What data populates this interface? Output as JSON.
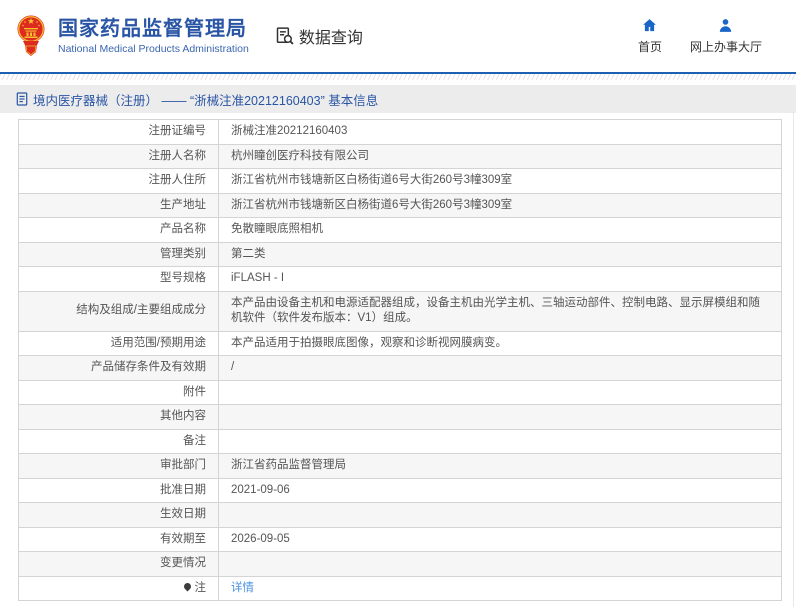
{
  "header": {
    "org_name_cn": "国家药品监督管理局",
    "org_name_en": "National Medical Products Administration",
    "query_label": "数据查询",
    "nav": {
      "home": "首页",
      "service_hall": "网上办事大厅"
    }
  },
  "breadcrumb": {
    "text": "境内医疗器械（注册） —— “浙械注准20212160403” 基本信息"
  },
  "icons": {
    "emblem": "china-national-emblem",
    "query": "document-search-icon",
    "home": "home-icon",
    "service_hall": "person-icon",
    "breadcrumb": "document-icon",
    "note": "pin-icon"
  },
  "colors": {
    "brand_blue": "#2a55a5",
    "rule_blue": "#1d5fb0",
    "icon_blue": "#1a66c8",
    "link_blue": "#4a90e2",
    "crumb_bg": "#ececec",
    "row_alt_bg": "#f6f6f6",
    "emblem_red": "#dd2b20",
    "emblem_gold": "#f6c12f"
  },
  "table": {
    "rows": [
      {
        "label": "注册证编号",
        "value": "浙械注准20212160403"
      },
      {
        "label": "注册人名称",
        "value": "杭州瞳创医疗科技有限公司"
      },
      {
        "label": "注册人住所",
        "value": "浙江省杭州市钱塘新区白杨街道6号大街260号3幢309室"
      },
      {
        "label": "生产地址",
        "value": "浙江省杭州市钱塘新区白杨街道6号大街260号3幢309室"
      },
      {
        "label": "产品名称",
        "value": "免散瞳眼底照相机"
      },
      {
        "label": "管理类别",
        "value": "第二类"
      },
      {
        "label": "型号规格",
        "value": "iFLASH - I"
      },
      {
        "label": "结构及组成/主要组成成分",
        "value": "本产品由设备主机和电源适配器组成，设备主机由光学主机、三轴运动部件、控制电路、显示屏模组和随机软件（软件发布版本：V1）组成。"
      },
      {
        "label": "适用范围/预期用途",
        "value": "本产品适用于拍摄眼底图像，观察和诊断视网膜病变。"
      },
      {
        "label": "产品储存条件及有效期",
        "value": "/"
      },
      {
        "label": "附件",
        "value": ""
      },
      {
        "label": "其他内容",
        "value": ""
      },
      {
        "label": "备注",
        "value": ""
      },
      {
        "label": "审批部门",
        "value": "浙江省药品监督管理局"
      },
      {
        "label": "批准日期",
        "value": "2021-09-06"
      },
      {
        "label": "生效日期",
        "value": ""
      },
      {
        "label": "有效期至",
        "value": "2026-09-05"
      },
      {
        "label": "变更情况",
        "value": ""
      },
      {
        "label": "注",
        "value": "详情",
        "value_type": "link",
        "label_icon": "pin-icon"
      }
    ]
  }
}
